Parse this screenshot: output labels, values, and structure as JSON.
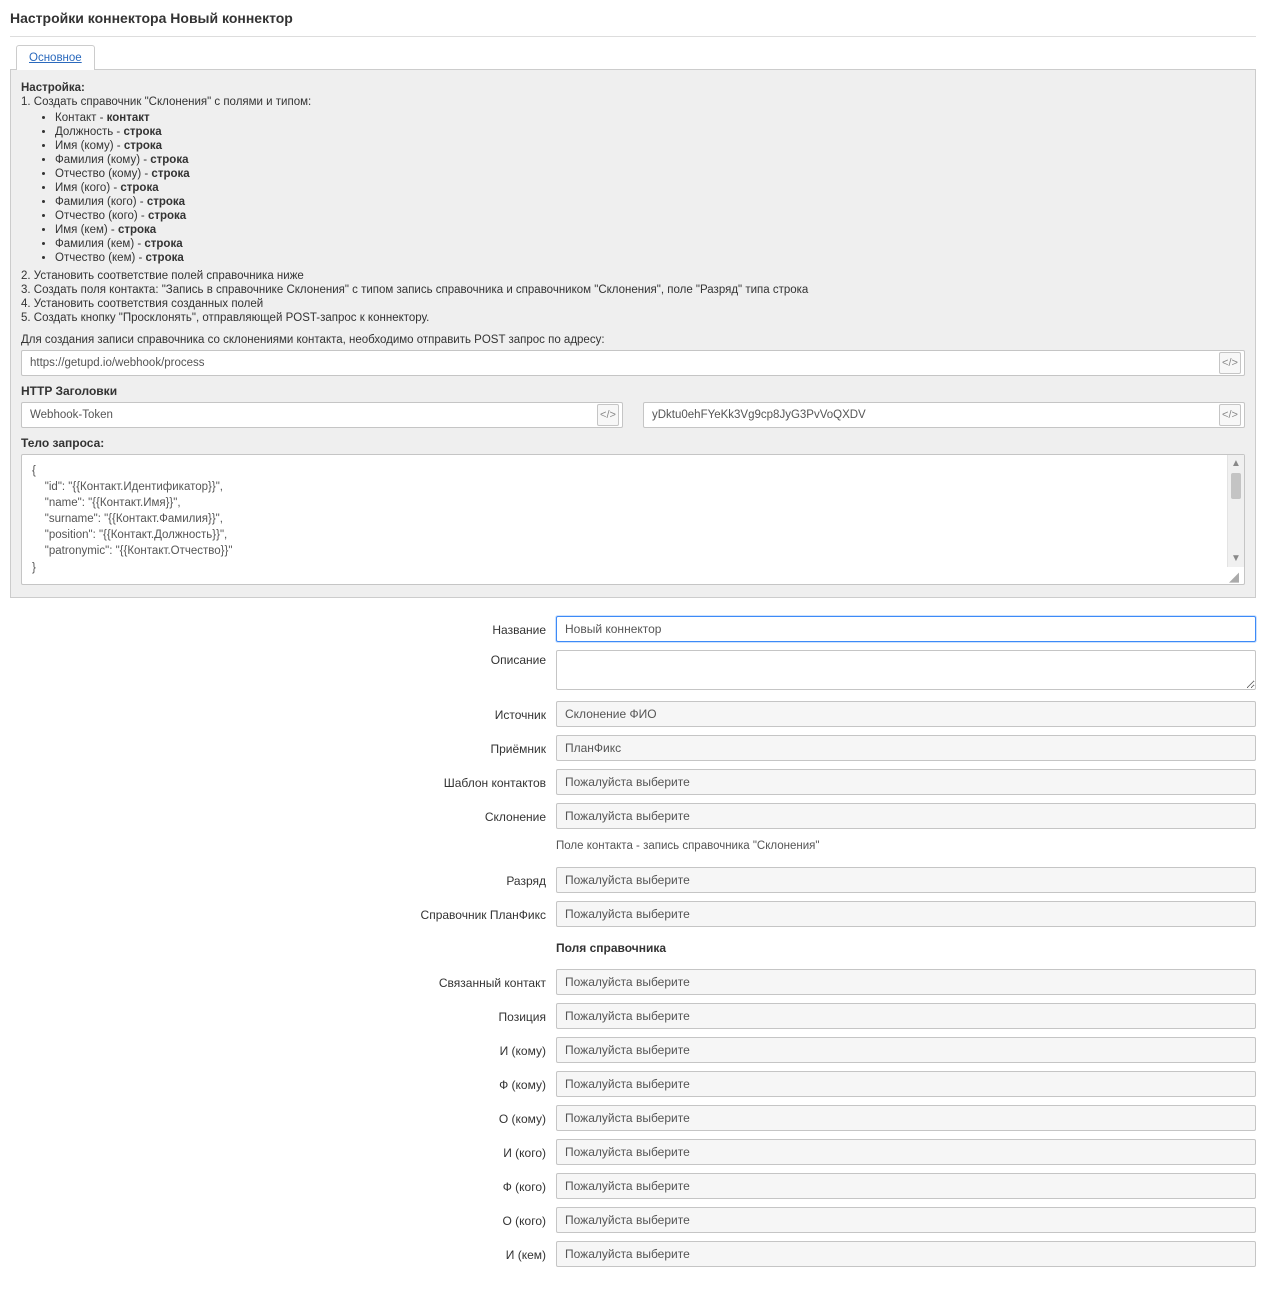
{
  "title": "Настройки коннектора Новый коннектор",
  "tabs": {
    "main": "Основное"
  },
  "setup": {
    "heading": "Настройка:",
    "step1": "1. Создать справочник \"Склонения\" с полями и типом:",
    "fields": [
      {
        "name": "Контакт",
        "type": "контакт"
      },
      {
        "name": "Должность",
        "type": "строка"
      },
      {
        "name": "Имя (кому)",
        "type": "строка"
      },
      {
        "name": "Фамилия (кому)",
        "type": "строка"
      },
      {
        "name": "Отчество (кому)",
        "type": "строка"
      },
      {
        "name": "Имя (кого)",
        "type": "строка"
      },
      {
        "name": "Фамилия (кого)",
        "type": "строка"
      },
      {
        "name": "Отчество (кого)",
        "type": "строка"
      },
      {
        "name": "Имя (кем)",
        "type": "строка"
      },
      {
        "name": "Фамилия (кем)",
        "type": "строка"
      },
      {
        "name": "Отчество (кем)",
        "type": "строка"
      }
    ],
    "step2": "2. Установить соответствие полей справочника ниже",
    "step3": "3. Создать поля контакта: \"Запись в справочнике Склонения\" с типом запись справочника и справочником \"Склонения\", поле \"Разряд\" типа строка",
    "step4": "4. Установить соответствия созданных полей",
    "step5": "5. Создать кнопку \"Просклонять\", отправляющей POST-запрос к коннектору.",
    "post_note": "Для создания записи справочника со склонениями контакта, необходимо отправить POST запрос по адресу:",
    "url": "https://getupd.io/webhook/process",
    "http_headers_title": "HTTP Заголовки",
    "header_name": "Webhook-Token",
    "header_value": "yDktu0ehFYeKk3Vg9cp8JyG3PvVoQXDV",
    "body_title": "Тело запроса:",
    "body_text": "{\n    \"id\": \"{{Контакт.Идентификатор}}\",\n    \"name\": \"{{Контакт.Имя}}\",\n    \"surname\": \"{{Контакт.Фамилия}}\",\n    \"position\": \"{{Контакт.Должность}}\",\n    \"patronymic\": \"{{Контакт.Отчество}}\"\n}"
  },
  "form": {
    "name_label": "Название",
    "name_value": "Новый коннектор",
    "desc_label": "Описание",
    "desc_value": "",
    "source_label": "Источник",
    "source_value": "Склонение ФИО",
    "receiver_label": "Приёмник",
    "receiver_value": "ПланФикс",
    "tpl_label": "Шаблон контактов",
    "tpl_value": "Пожалуйста выберите",
    "decl_label": "Склонение",
    "decl_value": "Пожалуйста выберите",
    "decl_hint": "Поле контакта - запись справочника \"Склонения\"",
    "rank_label": "Разряд",
    "rank_value": "Пожалуйста выберите",
    "ref_label": "Справочник ПланФикс",
    "ref_value": "Пожалуйста выберите",
    "section": "Поля справочника",
    "fields": [
      {
        "label": "Связанный контакт",
        "value": "Пожалуйста выберите"
      },
      {
        "label": "Позиция",
        "value": "Пожалуйста выберите"
      },
      {
        "label": "И (кому)",
        "value": "Пожалуйста выберите"
      },
      {
        "label": "Ф (кому)",
        "value": "Пожалуйста выберите"
      },
      {
        "label": "О (кому)",
        "value": "Пожалуйста выберите"
      },
      {
        "label": "И (кого)",
        "value": "Пожалуйста выберите"
      },
      {
        "label": "Ф (кого)",
        "value": "Пожалуйста выберите"
      },
      {
        "label": "О (кого)",
        "value": "Пожалуйста выберите"
      },
      {
        "label": "И (кем)",
        "value": "Пожалуйста выберите"
      }
    ]
  }
}
